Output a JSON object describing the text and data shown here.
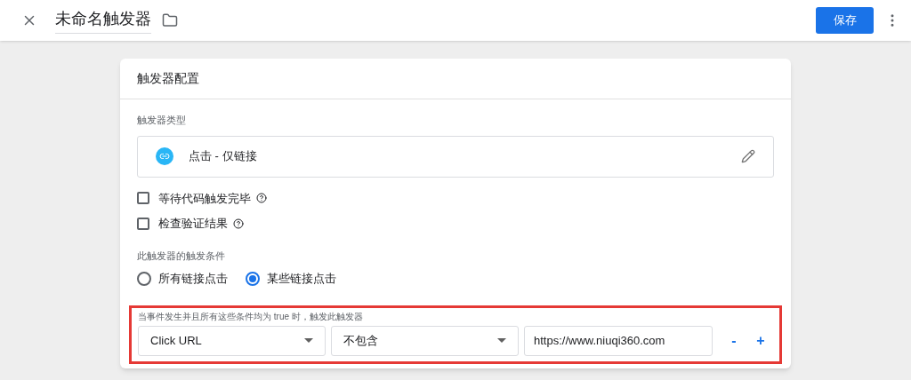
{
  "header": {
    "title": "未命名触发器",
    "save_label": "保存"
  },
  "card": {
    "title": "触发器配置",
    "type_label": "触发器类型",
    "type_value": "点击 - 仅链接",
    "options": [
      {
        "label": "等待代码触发完毕",
        "checked": false
      },
      {
        "label": "检查验证结果",
        "checked": false
      }
    ],
    "fire_label": "此触发器的触发条件",
    "fire_on": [
      {
        "label": "所有链接点击",
        "selected": false
      },
      {
        "label": "某些链接点击",
        "selected": true
      }
    ],
    "condition_hint": "当事件发生并且所有这些条件均为 true 时，触发此触发器",
    "condition": {
      "variable": "Click URL",
      "operator": "不包含",
      "value": "https://www.niuqi360.com",
      "remove": "-",
      "add": "+"
    }
  }
}
